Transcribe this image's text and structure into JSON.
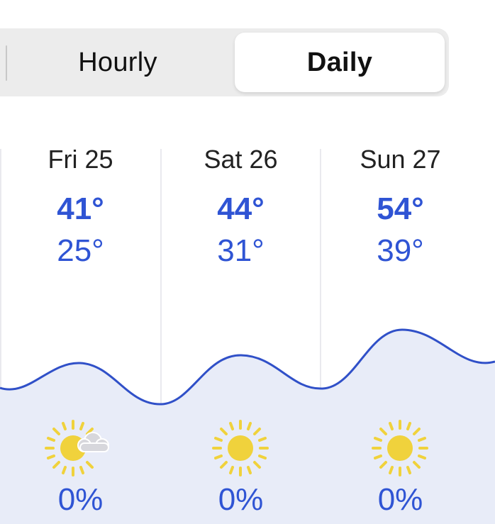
{
  "tabs": {
    "hourly_label": "Hourly",
    "daily_label": "Daily",
    "selected": "Daily"
  },
  "days": [
    {
      "label": "Fri 25",
      "high": "41°",
      "low": "25°",
      "icon": "sun-with-cloud-icon",
      "precip": "0%"
    },
    {
      "label": "Sat 26",
      "high": "44°",
      "low": "31°",
      "icon": "sun-icon",
      "precip": "0%"
    },
    {
      "label": "Sun 27",
      "high": "54°",
      "low": "39°",
      "icon": "sun-icon",
      "precip": "0%"
    }
  ],
  "colors": {
    "accent_blue": "#2f54d4",
    "curve_line": "#3050c8",
    "curve_fill": "#e8ecf8",
    "sun": "#f0d23c",
    "cloud": "#d7d7dc"
  }
}
